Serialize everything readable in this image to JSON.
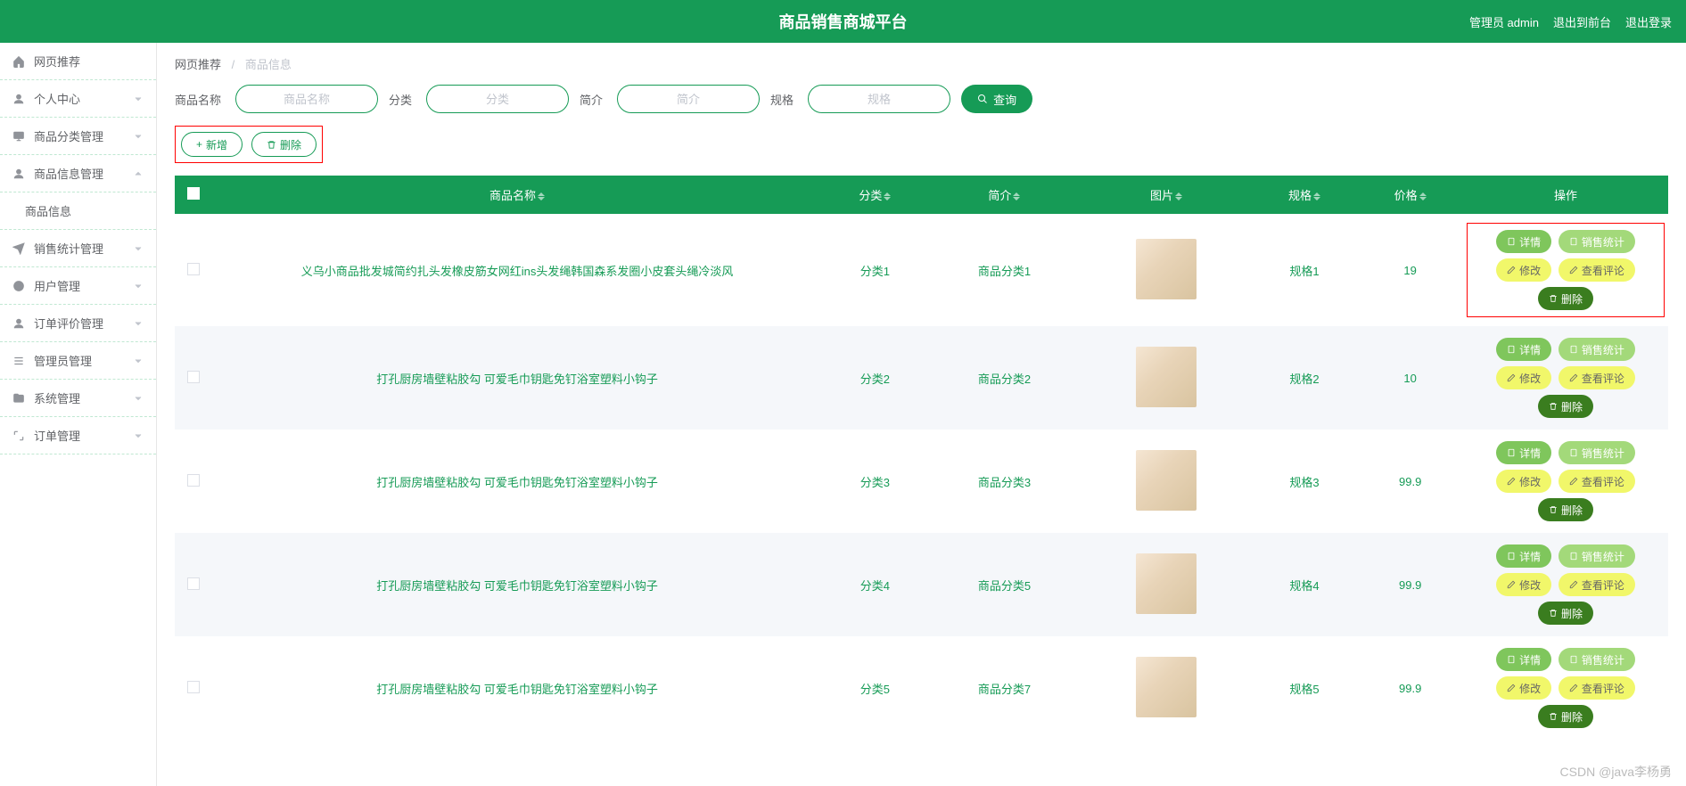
{
  "header": {
    "title": "商品销售商城平台",
    "right": {
      "user": "管理员 admin",
      "front": "退出到前台",
      "logout": "退出登录"
    }
  },
  "sidebar": {
    "items": [
      {
        "label": "网页推荐",
        "icon": "home",
        "expandable": false
      },
      {
        "label": "个人中心",
        "icon": "user",
        "expandable": true
      },
      {
        "label": "商品分类管理",
        "icon": "monitor",
        "expandable": true
      },
      {
        "label": "商品信息管理",
        "icon": "user",
        "expandable": true,
        "expanded": true,
        "children": [
          {
            "label": "商品信息"
          }
        ]
      },
      {
        "label": "销售统计管理",
        "icon": "send",
        "expandable": true
      },
      {
        "label": "用户管理",
        "icon": "clock",
        "expandable": true
      },
      {
        "label": "订单评价管理",
        "icon": "user",
        "expandable": true
      },
      {
        "label": "管理员管理",
        "icon": "list",
        "expandable": true
      },
      {
        "label": "系统管理",
        "icon": "folder",
        "expandable": true
      },
      {
        "label": "订单管理",
        "icon": "expand",
        "expandable": true
      }
    ]
  },
  "breadcrumb": {
    "root": "网页推荐",
    "active": "商品信息"
  },
  "search": {
    "name": {
      "label": "商品名称",
      "placeholder": "商品名称"
    },
    "category": {
      "label": "分类",
      "placeholder": "分类"
    },
    "intro": {
      "label": "简介",
      "placeholder": "简介"
    },
    "spec": {
      "label": "规格",
      "placeholder": "规格"
    },
    "btn": "查询"
  },
  "actions": {
    "add": "新增",
    "del": "删除"
  },
  "table": {
    "cols": {
      "name": "商品名称",
      "category": "分类",
      "intro": "简介",
      "img": "图片",
      "spec": "规格",
      "price": "价格",
      "ops": "操作"
    },
    "ops": {
      "detail": "详情",
      "stat": "销售统计",
      "edit": "修改",
      "comment": "查看评论",
      "del": "删除"
    },
    "rows": [
      {
        "name": "义乌小商品批发城简约扎头发橡皮筋女网红ins头发绳韩国森系发圈小皮套头绳冷淡风",
        "category": "分类1",
        "intro": "商品分类1",
        "spec": "规格1",
        "price": "19"
      },
      {
        "name": "打孔厨房墙壁粘胶勾 可爱毛巾钥匙免钉浴室塑料小钩子",
        "category": "分类2",
        "intro": "商品分类2",
        "spec": "规格2",
        "price": "10"
      },
      {
        "name": "打孔厨房墙壁粘胶勾 可爱毛巾钥匙免钉浴室塑料小钩子",
        "category": "分类3",
        "intro": "商品分类3",
        "spec": "规格3",
        "price": "99.9"
      },
      {
        "name": "打孔厨房墙壁粘胶勾 可爱毛巾钥匙免钉浴室塑料小钩子",
        "category": "分类4",
        "intro": "商品分类5",
        "spec": "规格4",
        "price": "99.9"
      },
      {
        "name": "打孔厨房墙壁粘胶勾 可爱毛巾钥匙免钉浴室塑料小钩子",
        "category": "分类5",
        "intro": "商品分类7",
        "spec": "规格5",
        "price": "99.9"
      }
    ]
  },
  "watermark": "CSDN @java李杨勇"
}
